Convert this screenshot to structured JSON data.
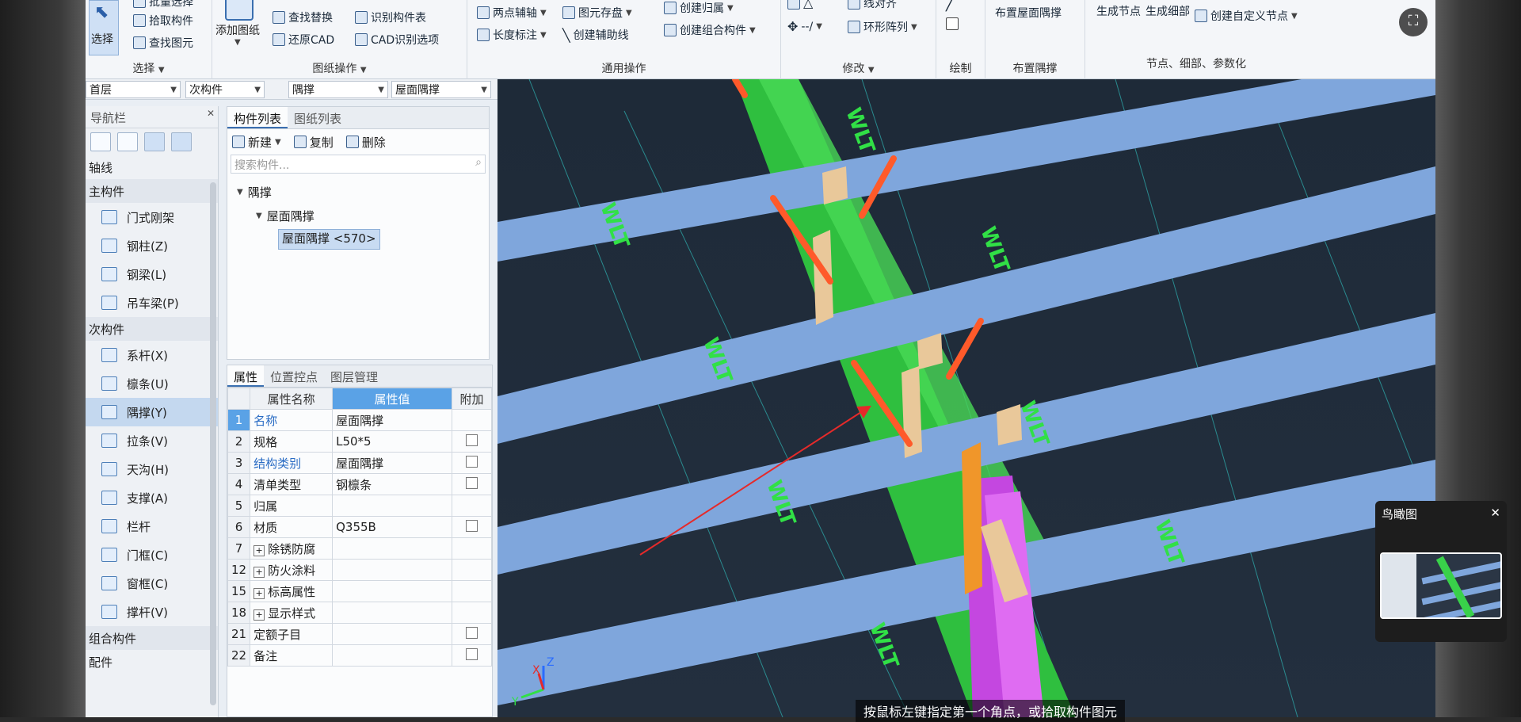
{
  "ribbon": {
    "select_group": {
      "select_label": "选择",
      "pick_label": "拾取构件",
      "find_label": "查找图元",
      "top_cut_label": "批量选择",
      "title": "选择"
    },
    "drawing_group": {
      "add_label": "添加图纸",
      "find_replace_label": "查找替换",
      "restore_cad_label": "还原CAD",
      "identify_table_label": "识别构件表",
      "cad_options_label": "CAD识别选项",
      "title": "图纸操作"
    },
    "general_group": {
      "two_point_axis_label": "两点辅轴",
      "length_mark_label": "长度标注",
      "element_save_label": "图元存盘",
      "create_aux_line_label": "创建辅助线",
      "create_owner_label": "创建归属",
      "create_combo_label": "创建组合构件",
      "title": "通用操作"
    },
    "modify_group": {
      "align_label": "线对齐",
      "ring_array_label": "环形阵列",
      "title": "修改"
    },
    "draw_group": {
      "title": "绘制"
    },
    "brace_group": {
      "layout_label": "布置屋面隅撑",
      "title": "布置隅撑"
    },
    "node_group": {
      "gen_node_label": "生成节点",
      "gen_detail_label": "生成细部",
      "custom_node_label": "创建自定义节点",
      "title": "节点、细部、参数化"
    }
  },
  "selectors": {
    "floor": "首层",
    "category": "次构件",
    "type": "隅撑",
    "subtype": "屋面隅撑"
  },
  "nav": {
    "title": "导航栏",
    "axis_label": "轴线",
    "main_cat": "主构件",
    "main_items": [
      {
        "label": "门式刚架",
        "icon": "portal-frame-icon"
      },
      {
        "label": "钢柱(Z)",
        "icon": "steel-column-icon"
      },
      {
        "label": "钢梁(L)",
        "icon": "steel-beam-icon"
      },
      {
        "label": "吊车梁(P)",
        "icon": "crane-beam-icon"
      }
    ],
    "sub_cat": "次构件",
    "sub_items": [
      {
        "label": "系杆(X)",
        "icon": "tie-rod-icon"
      },
      {
        "label": "檩条(U)",
        "icon": "purlin-icon"
      },
      {
        "label": "隅撑(Y)",
        "icon": "brace-icon",
        "active": true
      },
      {
        "label": "拉条(V)",
        "icon": "sag-rod-icon"
      },
      {
        "label": "天沟(H)",
        "icon": "gutter-icon"
      },
      {
        "label": "支撑(A)",
        "icon": "bracing-icon"
      },
      {
        "label": "栏杆",
        "icon": "railing-icon"
      },
      {
        "label": "门框(C)",
        "icon": "door-frame-icon"
      },
      {
        "label": "窗框(C)",
        "icon": "window-frame-icon"
      },
      {
        "label": "撑杆(V)",
        "icon": "strut-icon"
      }
    ],
    "combo_cat": "组合构件",
    "parts_cat": "配件"
  },
  "complist": {
    "tab_components": "构件列表",
    "tab_drawings": "图纸列表",
    "new_label": "新建",
    "copy_label": "复制",
    "delete_label": "删除",
    "search_placeholder": "搜索构件...",
    "tree_root": "隅撑",
    "tree_child": "屋面隅撑",
    "tree_leaf": "屋面隅撑 <570>"
  },
  "props": {
    "tab_attrs": "属性",
    "tab_position": "位置控点",
    "tab_layers": "图层管理",
    "col_name": "属性名称",
    "col_value": "属性值",
    "col_extra": "附加",
    "rows": [
      {
        "idx": "1",
        "name": "名称",
        "value": "屋面隅撑",
        "blue": true,
        "check": false,
        "expand": false
      },
      {
        "idx": "2",
        "name": "规格",
        "value": "L50*5",
        "blue": false,
        "check": true,
        "expand": false
      },
      {
        "idx": "3",
        "name": "结构类别",
        "value": "屋面隅撑",
        "blue": true,
        "check": true,
        "expand": false
      },
      {
        "idx": "4",
        "name": "清单类型",
        "value": "钢檩条",
        "blue": false,
        "check": true,
        "expand": false
      },
      {
        "idx": "5",
        "name": "归属",
        "value": "",
        "blue": false,
        "check": false,
        "expand": false
      },
      {
        "idx": "6",
        "name": "材质",
        "value": "Q355B",
        "blue": false,
        "check": true,
        "expand": false
      },
      {
        "idx": "7",
        "name": "除锈防腐",
        "value": "",
        "blue": false,
        "check": false,
        "expand": true
      },
      {
        "idx": "12",
        "name": "防火涂料",
        "value": "",
        "blue": false,
        "check": false,
        "expand": true
      },
      {
        "idx": "15",
        "name": "标高属性",
        "value": "",
        "blue": false,
        "check": false,
        "expand": true
      },
      {
        "idx": "18",
        "name": "显示样式",
        "value": "",
        "blue": false,
        "check": false,
        "expand": true
      },
      {
        "idx": "21",
        "name": "定额子目",
        "value": "",
        "blue": false,
        "check": true,
        "expand": false
      },
      {
        "idx": "22",
        "name": "备注",
        "value": "",
        "blue": false,
        "check": true,
        "expand": false
      }
    ]
  },
  "viewport": {
    "purlin_label": "WLT",
    "status_text": "按鼠标左键指定第一个角点，或拾取构件图元",
    "axis_x": "X",
    "axis_y": "Y",
    "axis_z": "Z"
  },
  "minimap": {
    "title": "鸟瞰图"
  },
  "colors": {
    "purlin": "#7fa6dc",
    "rafter": "#39d14a",
    "column": "#d24ee6",
    "brace": "#ff5a2a",
    "plate": "#e9c89a",
    "background": "#1f2b3a"
  }
}
